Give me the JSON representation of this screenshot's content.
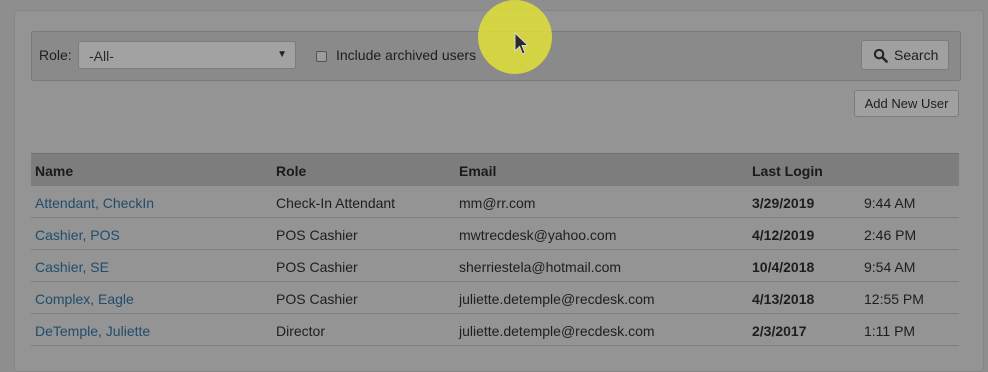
{
  "filter": {
    "role_label": "Role:",
    "role_value": "-All-",
    "include_archived_label": "Include archived users",
    "include_archived_checked": false,
    "search_label": "Search"
  },
  "add_user_label": "Add New User",
  "table": {
    "columns": {
      "name": "Name",
      "role": "Role",
      "email": "Email",
      "last_login": "Last Login"
    },
    "rows": [
      {
        "name": "Attendant, CheckIn",
        "role": "Check-In Attendant",
        "email": "mm@rr.com",
        "date": "3/29/2019",
        "time": "9:44 AM"
      },
      {
        "name": "Cashier, POS",
        "role": "POS Cashier",
        "email": "mwtrecdesk@yahoo.com",
        "date": "4/12/2019",
        "time": "2:46 PM"
      },
      {
        "name": "Cashier, SE",
        "role": "POS Cashier",
        "email": "sherriestela@hotmail.com",
        "date": "10/4/2018",
        "time": "9:54 AM"
      },
      {
        "name": "Complex, Eagle",
        "role": "POS Cashier",
        "email": "juliette.detemple@recdesk.com",
        "date": "4/13/2018",
        "time": "12:55 PM"
      },
      {
        "name": "DeTemple, Juliette",
        "role": "Director",
        "email": "juliette.detemple@recdesk.com",
        "date": "2/3/2017",
        "time": "1:11 PM"
      }
    ]
  },
  "icons": {
    "search": "search-icon",
    "dropdown": "chevron-down-icon",
    "cursor": "mouse-pointer-icon"
  },
  "colors": {
    "link": "#1f4d6c",
    "cursor_highlight": "#e1df37",
    "overlay_bg": "#8e8e8e"
  }
}
